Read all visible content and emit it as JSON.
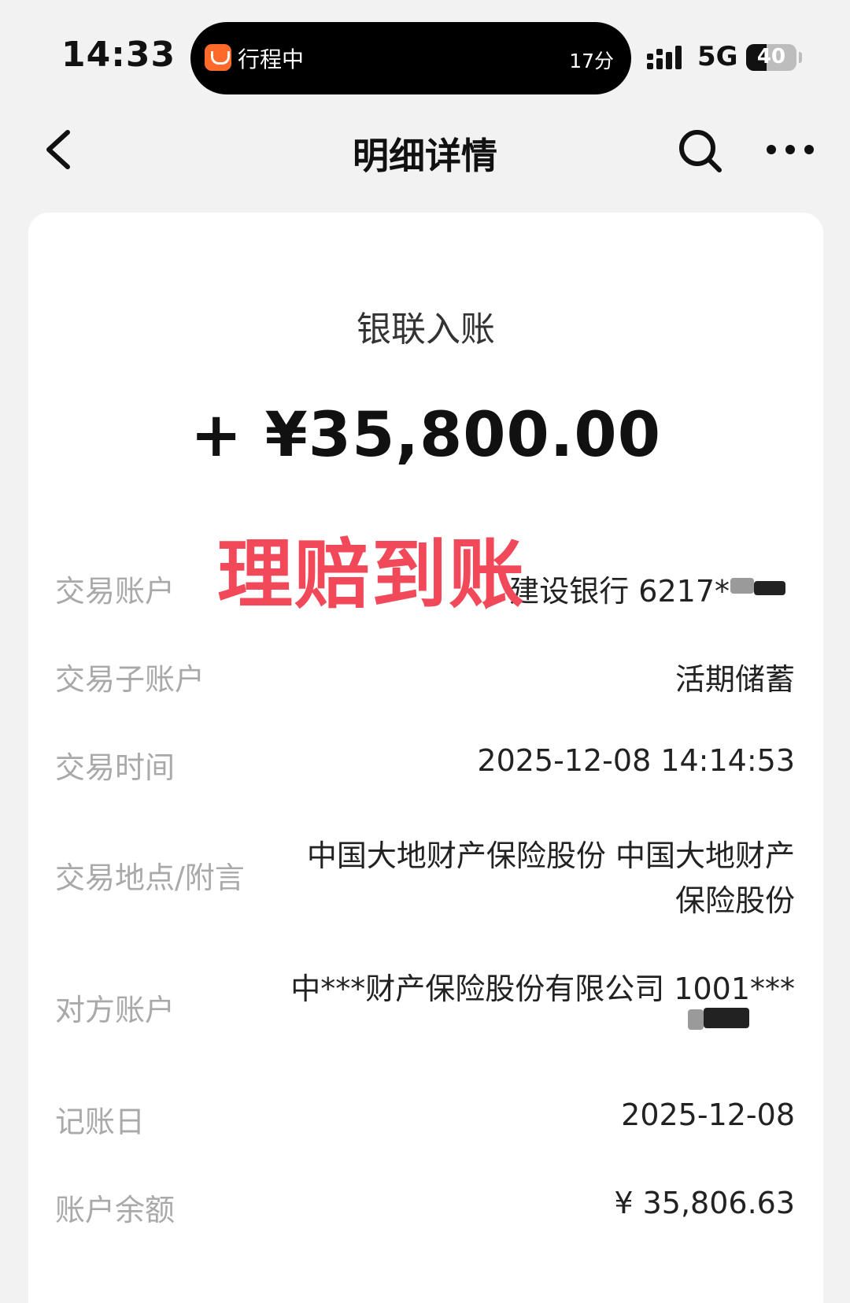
{
  "status_bar": {
    "time": "14:33",
    "island_text": "行程中",
    "island_time": "17分",
    "network": "5G",
    "battery": "40",
    "battery_level": 0.4
  },
  "nav": {
    "title": "明细详情",
    "back_icon": "chevron-left-icon",
    "search_icon": "search-icon",
    "more_icon": "more-icon"
  },
  "detail": {
    "type": "银联入账",
    "amount": "+ ¥35,800.00",
    "stamp": "理赔到账",
    "rows": [
      {
        "label": "交易账户",
        "value": "建设银行 6217**"
      },
      {
        "label": "交易子账户",
        "value": "活期储蓄"
      },
      {
        "label": "交易时间",
        "value": "2025-12-08 14:14:53"
      },
      {
        "label": "交易地点/附言",
        "value_line1": "中国大地财产保险股份 中国大地财产",
        "value_line2": "保险股份"
      },
      {
        "label": "对方账户",
        "value_line1": "中***财产保险股份有限公司 1001***"
      },
      {
        "label": "记账日",
        "value": "2025-12-08"
      },
      {
        "label": "账户余额",
        "value": "¥ 35,806.63"
      }
    ]
  },
  "colors": {
    "background": "#f2f2f2",
    "card": "#ffffff",
    "label": "#a9a9a9",
    "stamp": "#f2495a",
    "island_icon": "#ff6a2a"
  }
}
